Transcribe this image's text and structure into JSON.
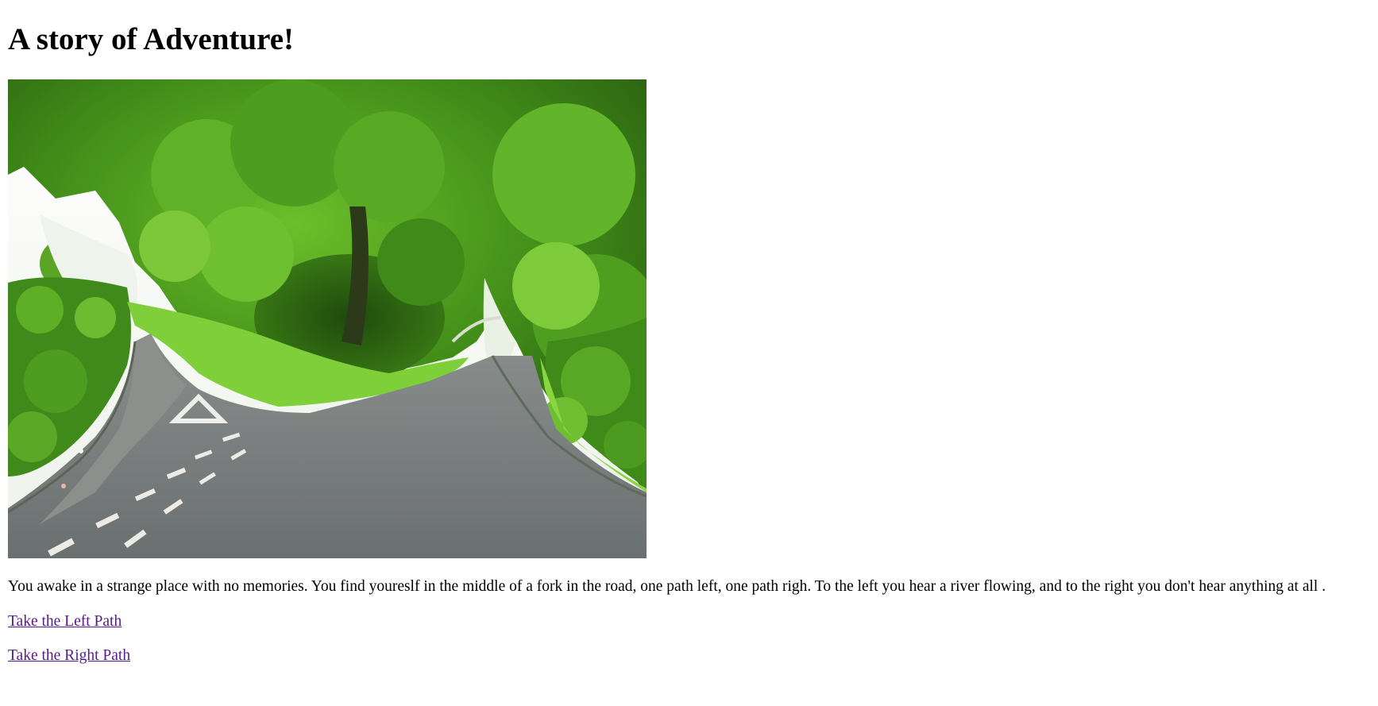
{
  "page": {
    "title": "A story of Adventure!"
  },
  "scene": {
    "image_name": "forked-country-road-photo",
    "colors": {
      "sky": "#f2f5ee",
      "foliage_dark": "#2f6b14",
      "foliage_mid": "#4d9a1c",
      "foliage_light": "#8fd23a",
      "grass": "#79c83a",
      "road": "#6f7474",
      "road_light": "#9a9d9b",
      "markings": "#e8e8e4"
    }
  },
  "story": {
    "text": "You awake in a strange place with no memories. You find youreslf in the middle of a fork in the road, one path left, one path righ. To the left you hear a river flowing, and to the right you don't hear anything at all ."
  },
  "choices": {
    "left_label": "Take the Left Path",
    "right_label": "Take the Right Path",
    "link_color": "#551a8b"
  }
}
